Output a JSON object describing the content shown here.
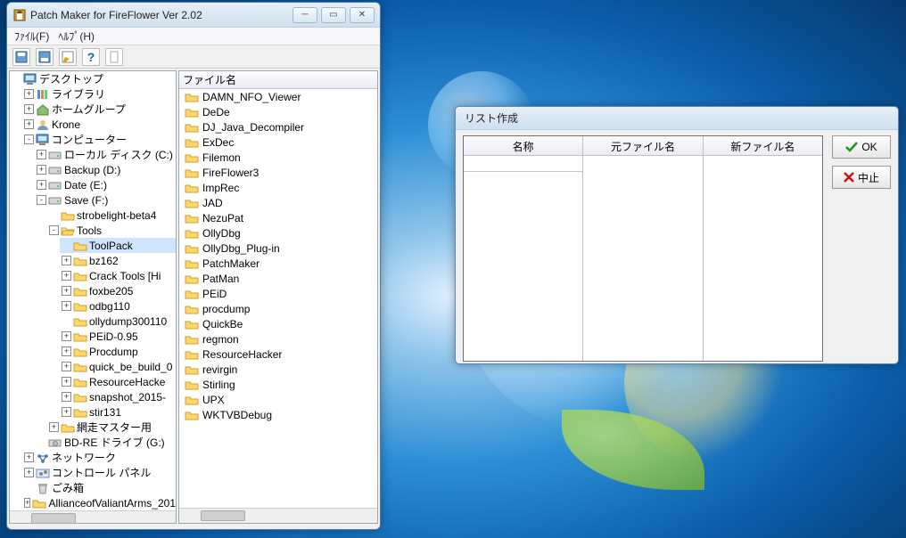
{
  "main_window": {
    "title": "Patch Maker for FireFlower Ver 2.02",
    "menu": {
      "file": "ﾌｧｲﾙ(F)",
      "help": "ﾍﾙﾌﾟ(H)"
    },
    "list_header": "ファイル名",
    "toolbar": {
      "save": "save-icon",
      "open": "open-icon",
      "edit": "edit-icon",
      "help": "help-icon",
      "sep": "sep-icon"
    }
  },
  "tree": {
    "root": "デスクトップ",
    "items": [
      {
        "label": "ライブラリ",
        "twist": "+",
        "icon": "lib-icon"
      },
      {
        "label": "ホームグループ",
        "twist": "+",
        "icon": "home-icon"
      },
      {
        "label": "Krone",
        "twist": "+",
        "icon": "user-icon"
      },
      {
        "label": "コンピューター",
        "twist": "-",
        "icon": "computer-icon",
        "children": [
          {
            "label": "ローカル ディスク (C:)",
            "twist": "+",
            "icon": "drive-icon"
          },
          {
            "label": "Backup (D:)",
            "twist": "+",
            "icon": "drive-icon"
          },
          {
            "label": "Date (E:)",
            "twist": "+",
            "icon": "drive-icon"
          },
          {
            "label": "Save (F:)",
            "twist": "-",
            "icon": "drive-icon",
            "children": [
              {
                "label": "strobelight-beta4",
                "twist": "",
                "icon": "folder-icon"
              },
              {
                "label": "Tools",
                "twist": "-",
                "icon": "folder-open-icon",
                "children": [
                  {
                    "label": "ToolPack",
                    "twist": "",
                    "icon": "folder-icon",
                    "selected": true
                  },
                  {
                    "label": "bz162",
                    "twist": "+",
                    "icon": "folder-icon"
                  },
                  {
                    "label": "Crack Tools [Hi",
                    "twist": "+",
                    "icon": "folder-icon"
                  },
                  {
                    "label": "foxbe205",
                    "twist": "+",
                    "icon": "folder-icon"
                  },
                  {
                    "label": "odbg110",
                    "twist": "+",
                    "icon": "folder-icon"
                  },
                  {
                    "label": "ollydump300110",
                    "twist": "",
                    "icon": "folder-icon"
                  },
                  {
                    "label": "PEiD-0.95",
                    "twist": "+",
                    "icon": "folder-icon"
                  },
                  {
                    "label": "Procdump",
                    "twist": "+",
                    "icon": "folder-icon"
                  },
                  {
                    "label": "quick_be_build_0",
                    "twist": "+",
                    "icon": "folder-icon"
                  },
                  {
                    "label": "ResourceHacke",
                    "twist": "+",
                    "icon": "folder-icon"
                  },
                  {
                    "label": "snapshot_2015-",
                    "twist": "+",
                    "icon": "folder-icon"
                  },
                  {
                    "label": "stir131",
                    "twist": "+",
                    "icon": "folder-icon"
                  }
                ]
              },
              {
                "label": "網走マスター用",
                "twist": "+",
                "icon": "folder-icon"
              }
            ]
          },
          {
            "label": "BD-RE ドライブ (G:)",
            "twist": "",
            "icon": "optical-icon"
          }
        ]
      },
      {
        "label": "ネットワーク",
        "twist": "+",
        "icon": "network-icon"
      },
      {
        "label": "コントロール パネル",
        "twist": "+",
        "icon": "cpl-icon"
      },
      {
        "label": "ごみ箱",
        "twist": "",
        "icon": "trash-icon"
      },
      {
        "label": "AllianceofValiantArms_201",
        "twist": "+",
        "icon": "folder-icon"
      }
    ]
  },
  "files": [
    "DAMN_NFO_Viewer",
    "DeDe",
    "DJ_Java_Decompiler",
    "ExDec",
    "Filemon",
    "FireFlower3",
    "ImpRec",
    "JAD",
    "NezuPat",
    "OllyDbg",
    "OllyDbg_Plug-in",
    "PatchMaker",
    "PatMan",
    "PEiD",
    "procdump",
    "QuickBe",
    "regmon",
    "ResourceHacker",
    "revirgin",
    "Stirling",
    "UPX",
    "WKTVBDebug"
  ],
  "dialog": {
    "title": "リスト作成",
    "col1": "名称",
    "col2": "元ファイル名",
    "col3": "新ファイル名",
    "ok": "OK",
    "cancel": "中止"
  }
}
